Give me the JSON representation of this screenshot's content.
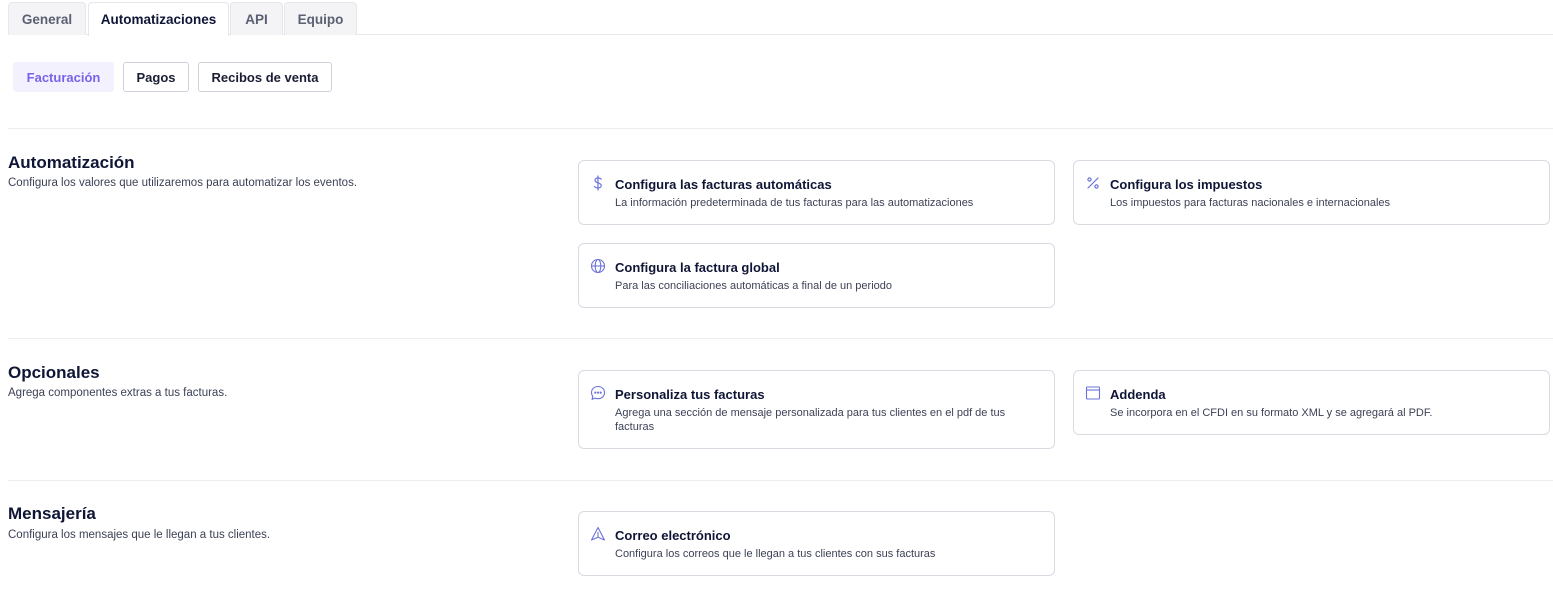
{
  "tabs": [
    {
      "label": "General"
    },
    {
      "label": "Automatizaciones"
    },
    {
      "label": "API"
    },
    {
      "label": "Equipo"
    }
  ],
  "subtabs": [
    {
      "label": "Facturación"
    },
    {
      "label": "Pagos"
    },
    {
      "label": "Recibos de venta"
    }
  ],
  "sections": {
    "automatizacion": {
      "title": "Automatización",
      "description": "Configura los valores que utilizaremos para automatizar los eventos.",
      "cards": [
        {
          "icon": "dollar-icon",
          "title": "Configura las facturas automáticas",
          "description": "La información predeterminada de tus facturas para las automatizaciones"
        },
        {
          "icon": "percent-icon",
          "title": "Configura los impuestos",
          "description": "Los impuestos para facturas nacionales e internacionales"
        },
        {
          "icon": "globe-icon",
          "title": "Configura la factura global",
          "description": "Para las conciliaciones automáticas a final de un periodo"
        }
      ]
    },
    "opcionales": {
      "title": "Opcionales",
      "description": "Agrega componentes extras a tus facturas.",
      "cards": [
        {
          "icon": "message-icon",
          "title": "Personaliza tus facturas",
          "description": "Agrega una sección de mensaje personalizada para tus clientes en el pdf de tus facturas"
        },
        {
          "icon": "window-icon",
          "title": "Addenda",
          "description": "Se incorpora en el CFDI en su formato XML y se agregará al PDF."
        }
      ]
    },
    "mensajeria": {
      "title": "Mensajería",
      "description": "Configura los mensajes que le llegan a tus clientes.",
      "cards": [
        {
          "icon": "send-icon",
          "title": "Correo electrónico",
          "description": "Configura los correos que le llegan a tus clientes con sus facturas"
        }
      ]
    }
  },
  "colors": {
    "accent": "#7a63e8",
    "icon": "#6b73d8",
    "text": "#0f1535",
    "border": "#d9dbe3"
  }
}
